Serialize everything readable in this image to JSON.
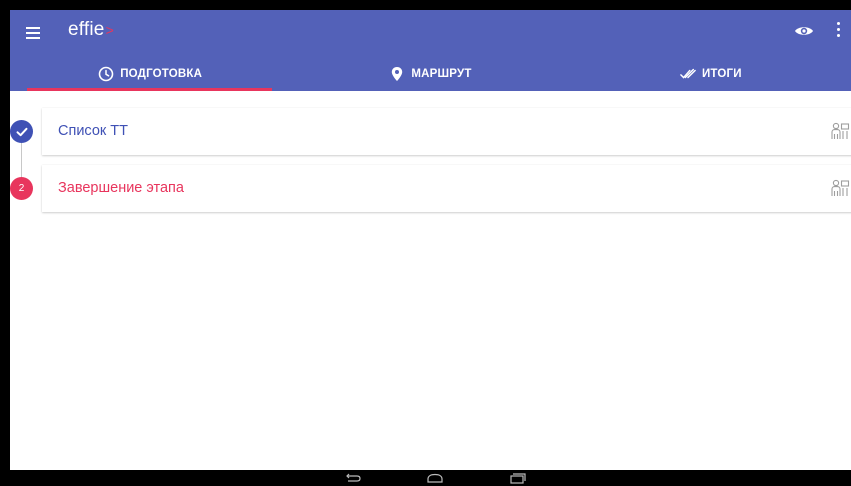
{
  "app": {
    "logo_text": "effie",
    "logo_caret": ">"
  },
  "tabs": [
    {
      "label": "ПОДГОТОВКА",
      "icon": "clock-icon",
      "selected": true
    },
    {
      "label": "МАРШРУТ",
      "icon": "map-pin-icon",
      "selected": false
    },
    {
      "label": "ИТОГИ",
      "icon": "double-check-icon",
      "selected": false
    }
  ],
  "steps": [
    {
      "badge": "",
      "label": "Список ТТ",
      "state": "done"
    },
    {
      "badge": "2",
      "label": "Завершение этапа",
      "state": "active"
    }
  ],
  "colors": {
    "appbar": "#5361b8",
    "accent": "#e8355d",
    "primary": "#3f51b5"
  }
}
